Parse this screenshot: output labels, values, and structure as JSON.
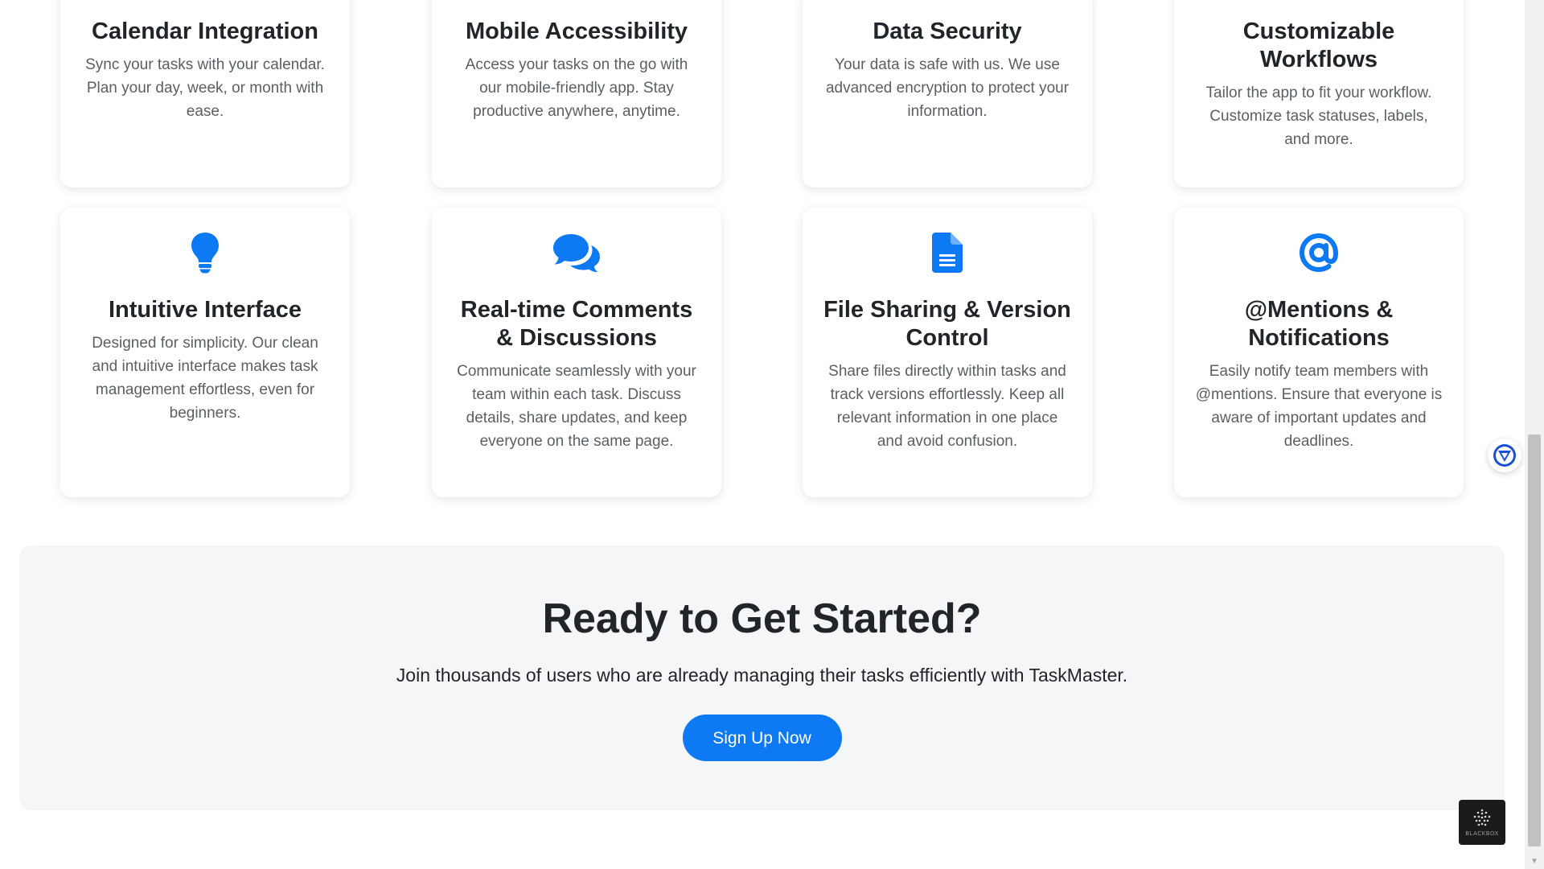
{
  "features_row1": [
    {
      "title": "Calendar Integration",
      "description": "Sync your tasks with your calendar. Plan your day, week, or month with ease."
    },
    {
      "title": "Mobile Accessibility",
      "description": "Access your tasks on the go with our mobile-friendly app. Stay productive anywhere, anytime."
    },
    {
      "title": "Data Security",
      "description": "Your data is safe with us. We use advanced encryption to protect your information."
    },
    {
      "title": "Customizable Workflows",
      "description": "Tailor the app to fit your workflow. Customize task statuses, labels, and more."
    }
  ],
  "features_row2": [
    {
      "icon": "lightbulb-icon",
      "title": "Intuitive Interface",
      "description": "Designed for simplicity. Our clean and intuitive interface makes task management effortless, even for beginners."
    },
    {
      "icon": "comments-icon",
      "title": "Real-time Comments & Discussions",
      "description": "Communicate seamlessly with your team within each task. Discuss details, share updates, and keep everyone on the same page."
    },
    {
      "icon": "document-icon",
      "title": "File Sharing & Version Control",
      "description": "Share files directly within tasks and track versions effortlessly. Keep all relevant information in one place and avoid confusion."
    },
    {
      "icon": "at-sign-icon",
      "title": "@Mentions & Notifications",
      "description": "Easily notify team members with @mentions. Ensure that everyone is aware of important updates and deadlines."
    }
  ],
  "cta": {
    "title": "Ready to Get Started?",
    "text": "Join thousands of users who are already managing their tasks efficiently with TaskMaster.",
    "button_label": "Sign Up Now"
  },
  "widgets": {
    "box_label": "BLACKBOX"
  },
  "colors": {
    "accent": "#0d79f2",
    "cta_background": "#f5f6f8",
    "heading": "#212529",
    "body_text": "#5a5f64"
  }
}
